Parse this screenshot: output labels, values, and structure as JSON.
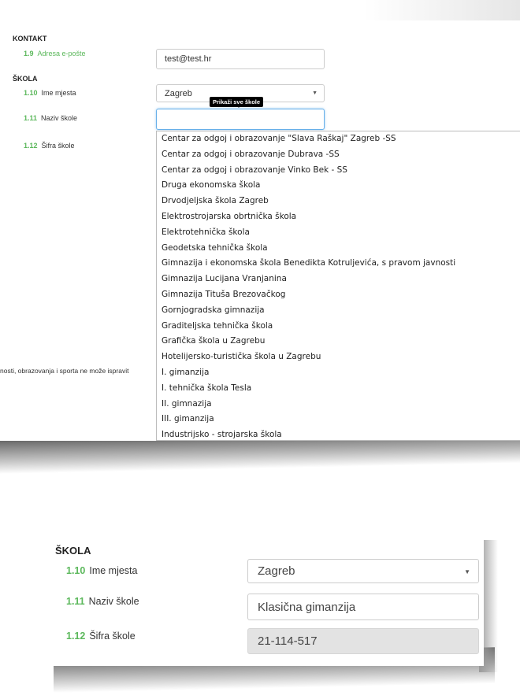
{
  "form": {
    "kontakt_heading": "KONTAKT",
    "email": {
      "number": "1.9",
      "label": "Adresa e-pošte",
      "value": "test@test.hr"
    },
    "skola_heading": "ŠKOLA",
    "city": {
      "number": "1.10",
      "label": "Ime mjesta",
      "value": "Zagreb"
    },
    "school": {
      "number": "1.11",
      "label": "Naziv škole",
      "value": ""
    },
    "school_code": {
      "number": "1.12",
      "label": "Šifra škole"
    },
    "tooltip": "Prikaži sve škole",
    "cutoff_text": "nosti, obrazovanja i sporta ne može ispravit"
  },
  "dropdown_items": [
    "Centar za odgoj i obrazovanje \"Slava Raškaj\" Zagreb -SS",
    "Centar za odgoj i obrazovanje Dubrava -SS",
    "Centar za odgoj i obrazovanje Vinko Bek - SS",
    "Druga ekonomska škola",
    "Drvodjeljska škola Zagreb",
    "Elektrostrojarska obrtnička škola",
    "Elektrotehnička škola",
    "Geodetska tehnička škola",
    "Gimnazija i ekonomska škola Benedikta Kotruljevića, s pravom javnosti",
    "Gimnazija Lucijana Vranjanina",
    "Gimnazija Tituša Brezovačkog",
    "Gornjogradska gimnazija",
    "Graditeljska tehnička škola",
    "Grafička škola u Zagrebu",
    "Hotelijersko-turistička škola u Zagrebu",
    "I. gimanzija",
    "I. tehnička škola Tesla",
    "II. gimnazija",
    "III. gimanzija",
    "Industrijsko - strojarska škola"
  ],
  "filled": {
    "skola_heading": "ŠKOLA",
    "city": {
      "number": "1.10",
      "label": "Ime mjesta",
      "value": "Zagreb"
    },
    "school": {
      "number": "1.11",
      "label": "Naziv škole",
      "value": "Klasična gimanzija"
    },
    "school_code": {
      "number": "1.12",
      "label": "Šifra škole",
      "value": "21-114-517"
    }
  }
}
